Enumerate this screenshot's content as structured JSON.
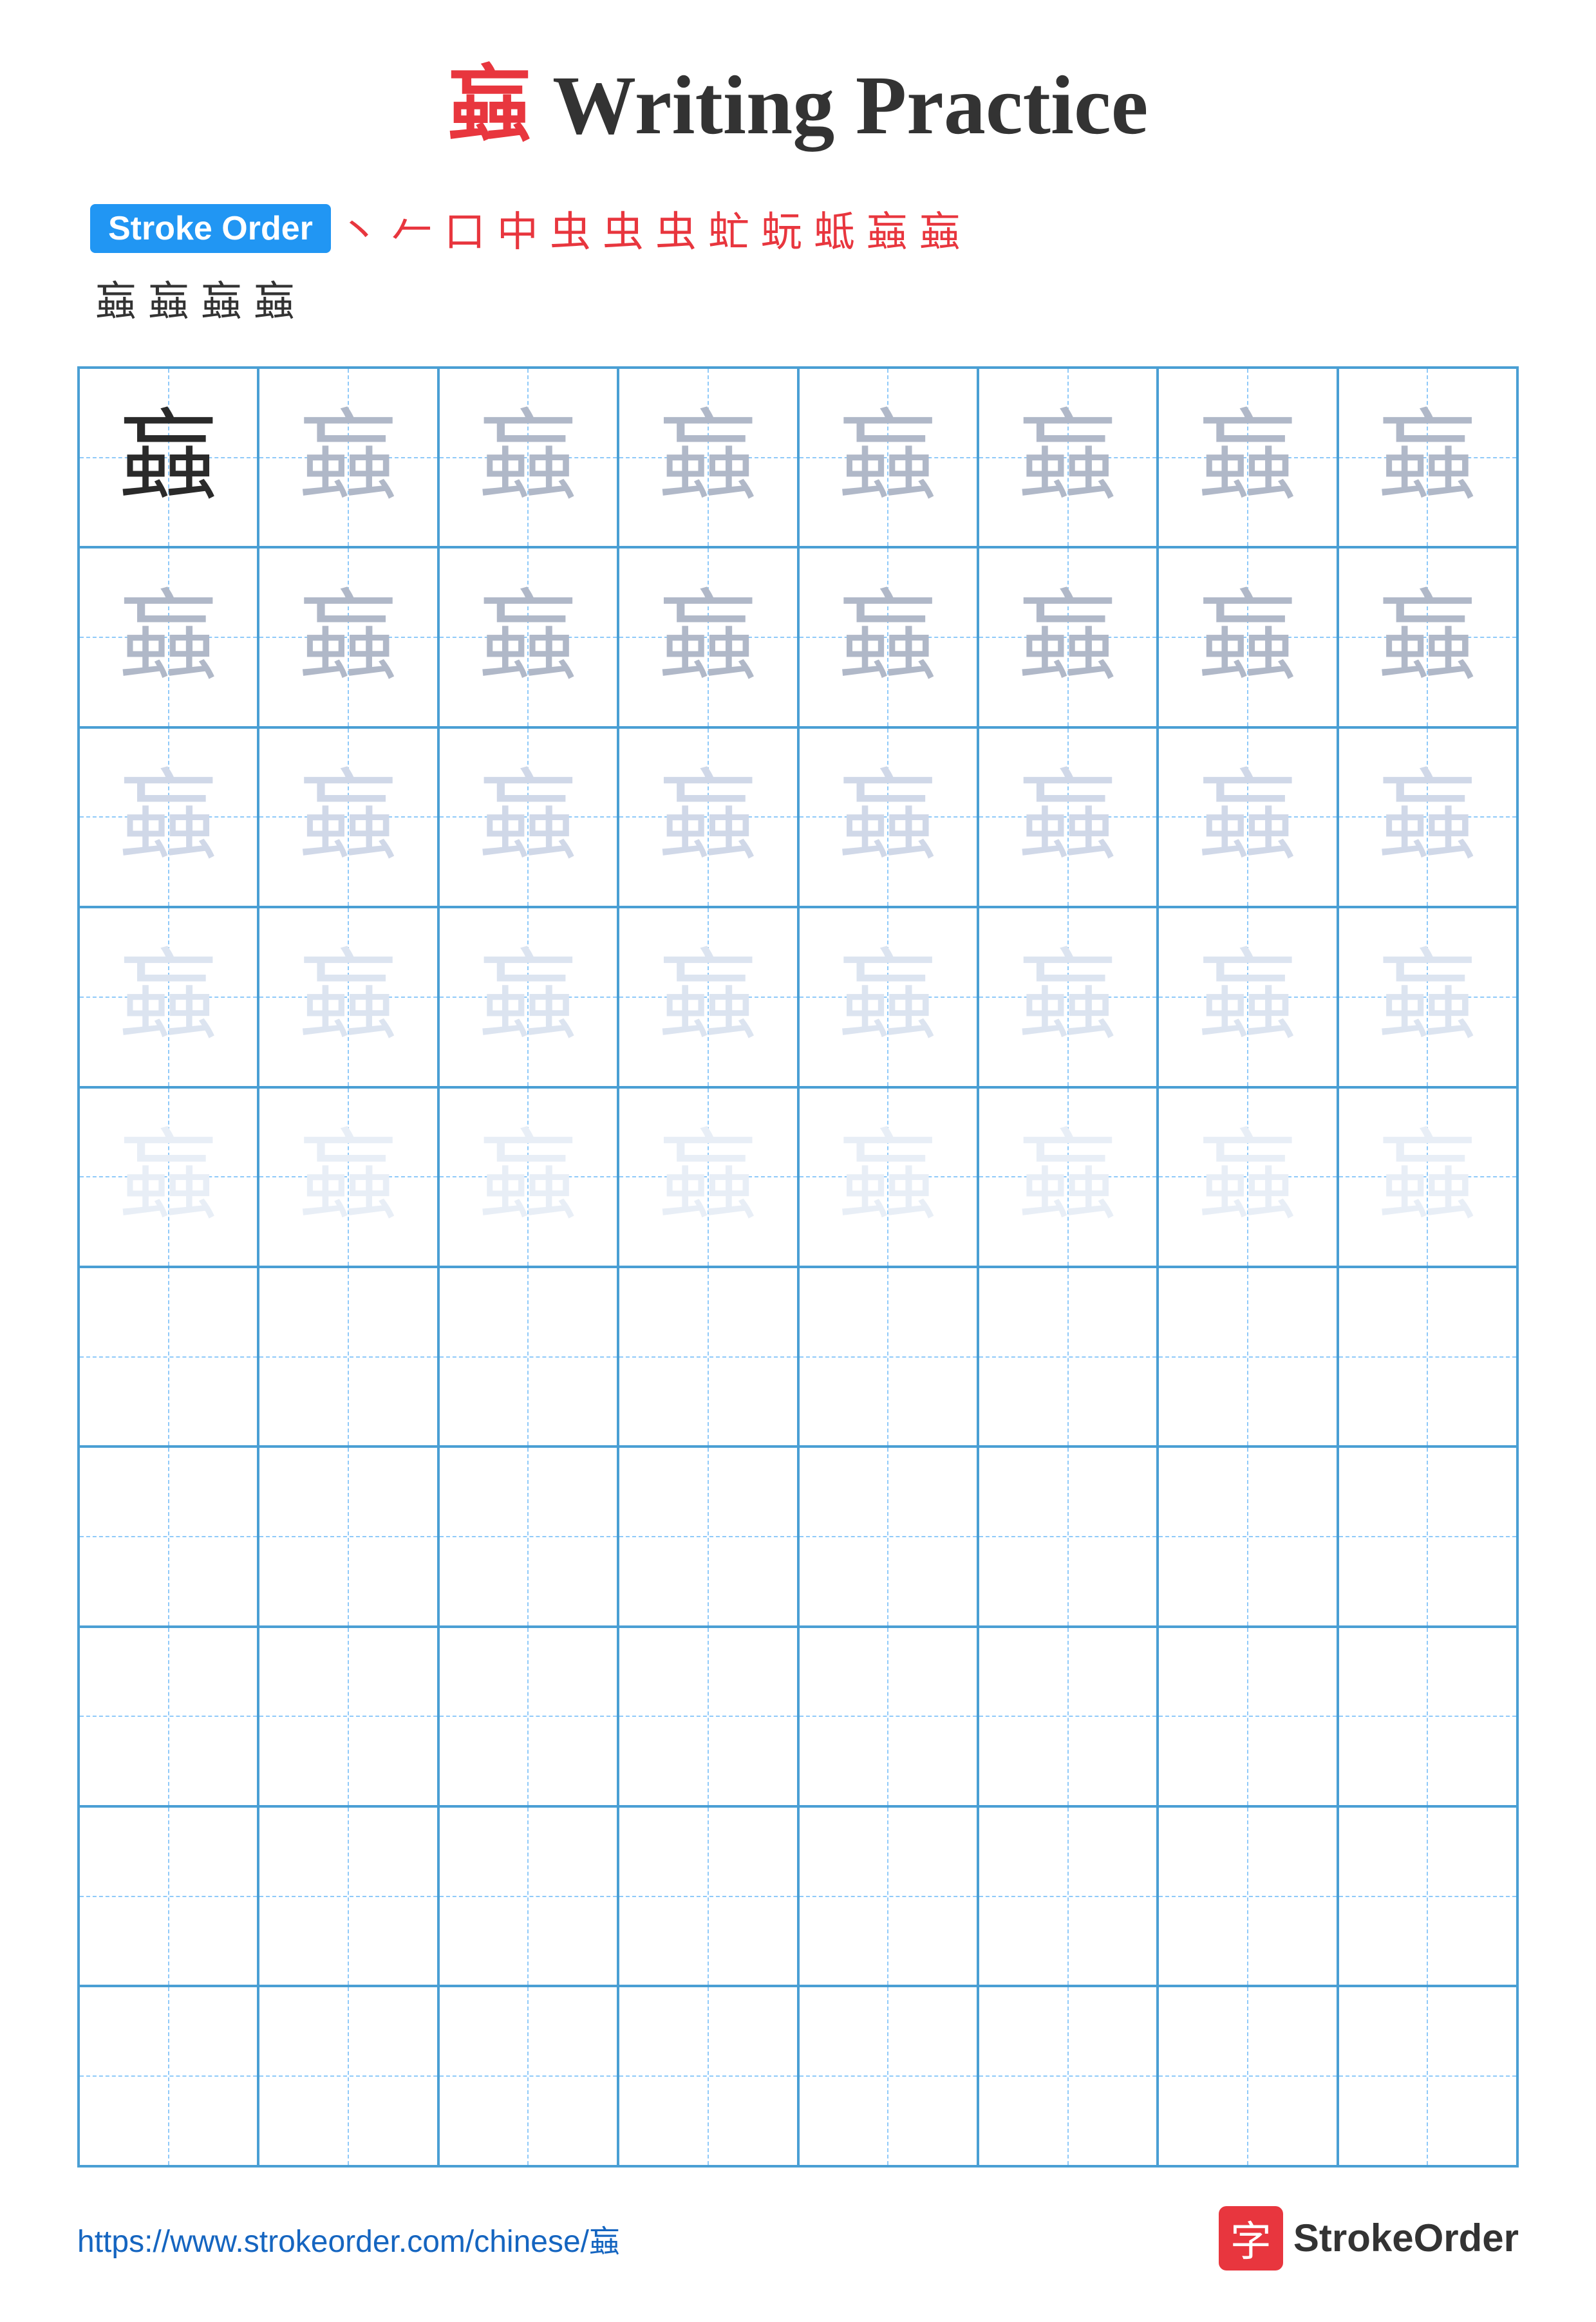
{
  "title": {
    "char": "蝱",
    "suffix": " Writing Practice"
  },
  "stroke_order": {
    "badge_label": "Stroke Order",
    "strokes_row1": [
      "丶",
      "𠂉",
      "口",
      "中",
      "虫",
      "虫",
      "虫",
      "虫⁻",
      "虺",
      "蚖",
      "蚳",
      "蝱"
    ],
    "strokes_row2": [
      "蝱",
      "蝱",
      "蝱",
      "蝱"
    ]
  },
  "grid": {
    "char": "蝱",
    "rows": 10,
    "cols": 8
  },
  "footer": {
    "url": "https://www.strokeorder.com/chinese/蝱",
    "brand_char": "字",
    "brand_name": "StrokeOrder"
  },
  "colors": {
    "accent_blue": "#2196F3",
    "accent_red": "#e8363e",
    "grid_blue": "#4a9fd4",
    "grid_dashed": "#90caf9",
    "text_dark": "#2a2a2a"
  }
}
